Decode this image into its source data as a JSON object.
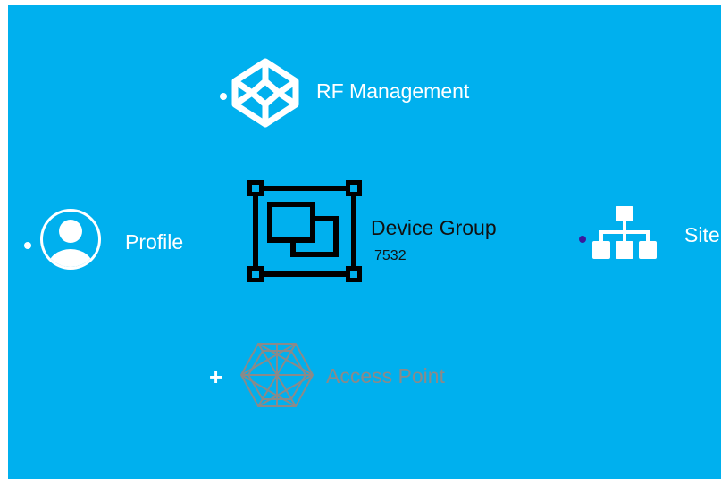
{
  "colors": {
    "background": "#00b0ee",
    "page": "#ffffff",
    "node_text": "#ffffff",
    "selected_text": "#111111",
    "selected_icon": "#000000",
    "disabled": "#8a8a8a",
    "site_dot": "#3a1a9c"
  },
  "nodes": {
    "rf_management": {
      "label": "RF Management",
      "icon": "codepen-cube-icon",
      "marker": "dot"
    },
    "profile": {
      "label": "Profile",
      "icon": "user-circle-icon",
      "marker": "dot"
    },
    "device_group": {
      "label": "Device Group",
      "count": "7532",
      "icon": "device-group-icon",
      "state": "selected"
    },
    "site": {
      "label": "Site",
      "icon": "sitemap-icon",
      "marker": "dot"
    },
    "access_point": {
      "label": "Access Point",
      "icon": "hexagon-network-icon",
      "marker": "+",
      "state": "disabled"
    }
  }
}
